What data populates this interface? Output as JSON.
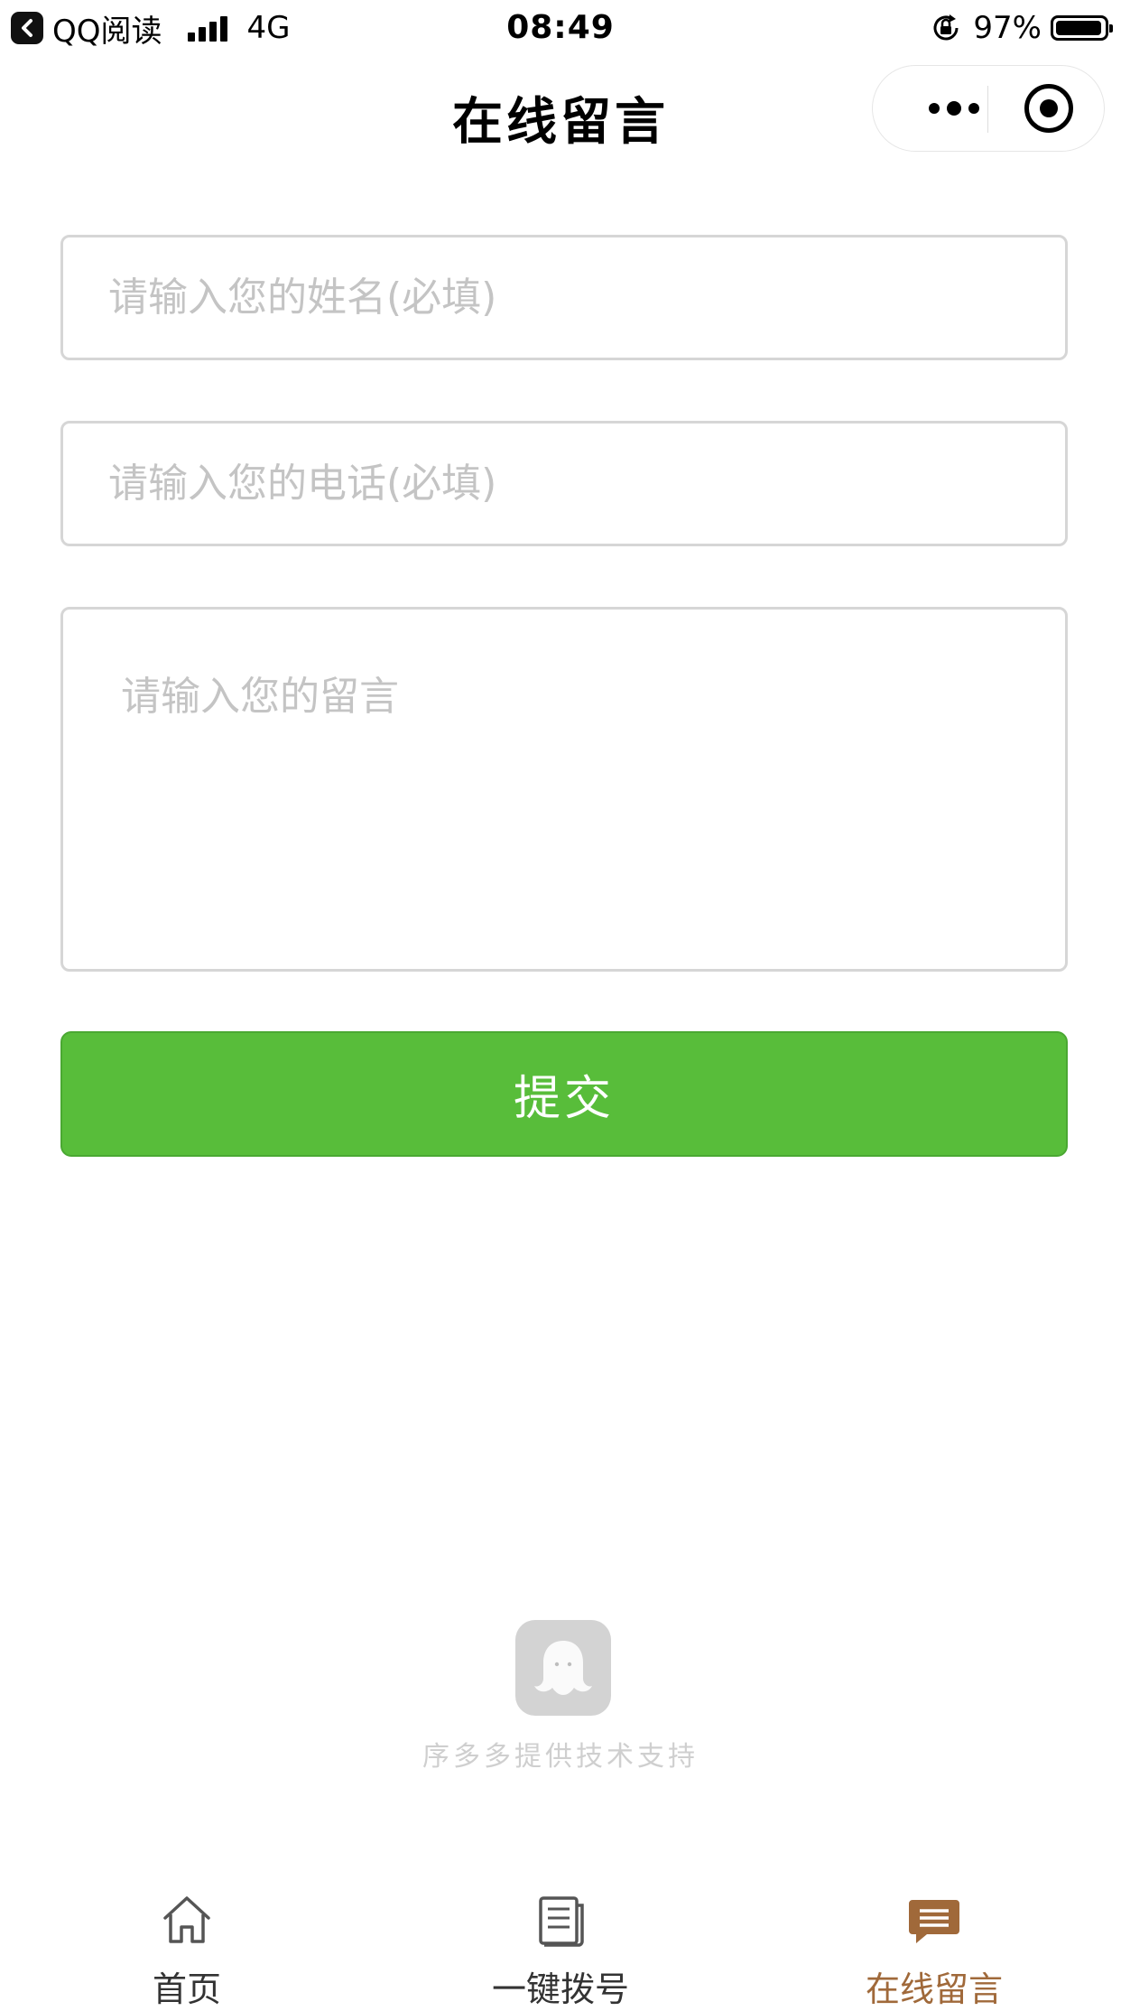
{
  "status_bar": {
    "back_app": "QQ阅读",
    "network": "4G",
    "time": "08:49",
    "battery": "97%",
    "battery_level": 0.97
  },
  "navbar": {
    "title": "在线留言"
  },
  "form": {
    "name_placeholder": "请输入您的姓名(必填)",
    "phone_placeholder": "请输入您的电话(必填)",
    "message_placeholder": "请输入您的留言",
    "submit_label": "提交"
  },
  "footer": {
    "support_text": "序多多提供技术支持"
  },
  "tabbar": {
    "items": [
      {
        "label": "首页",
        "icon": "home-icon",
        "active": false
      },
      {
        "label": "一键拨号",
        "icon": "document-icon",
        "active": false
      },
      {
        "label": "在线留言",
        "icon": "message-icon",
        "active": true
      }
    ]
  },
  "colors": {
    "submit_green": "#58bd3a",
    "active_tab": "#a0693a",
    "placeholder_gray": "#c4c4c4",
    "border_gray": "#d6d6d6"
  }
}
